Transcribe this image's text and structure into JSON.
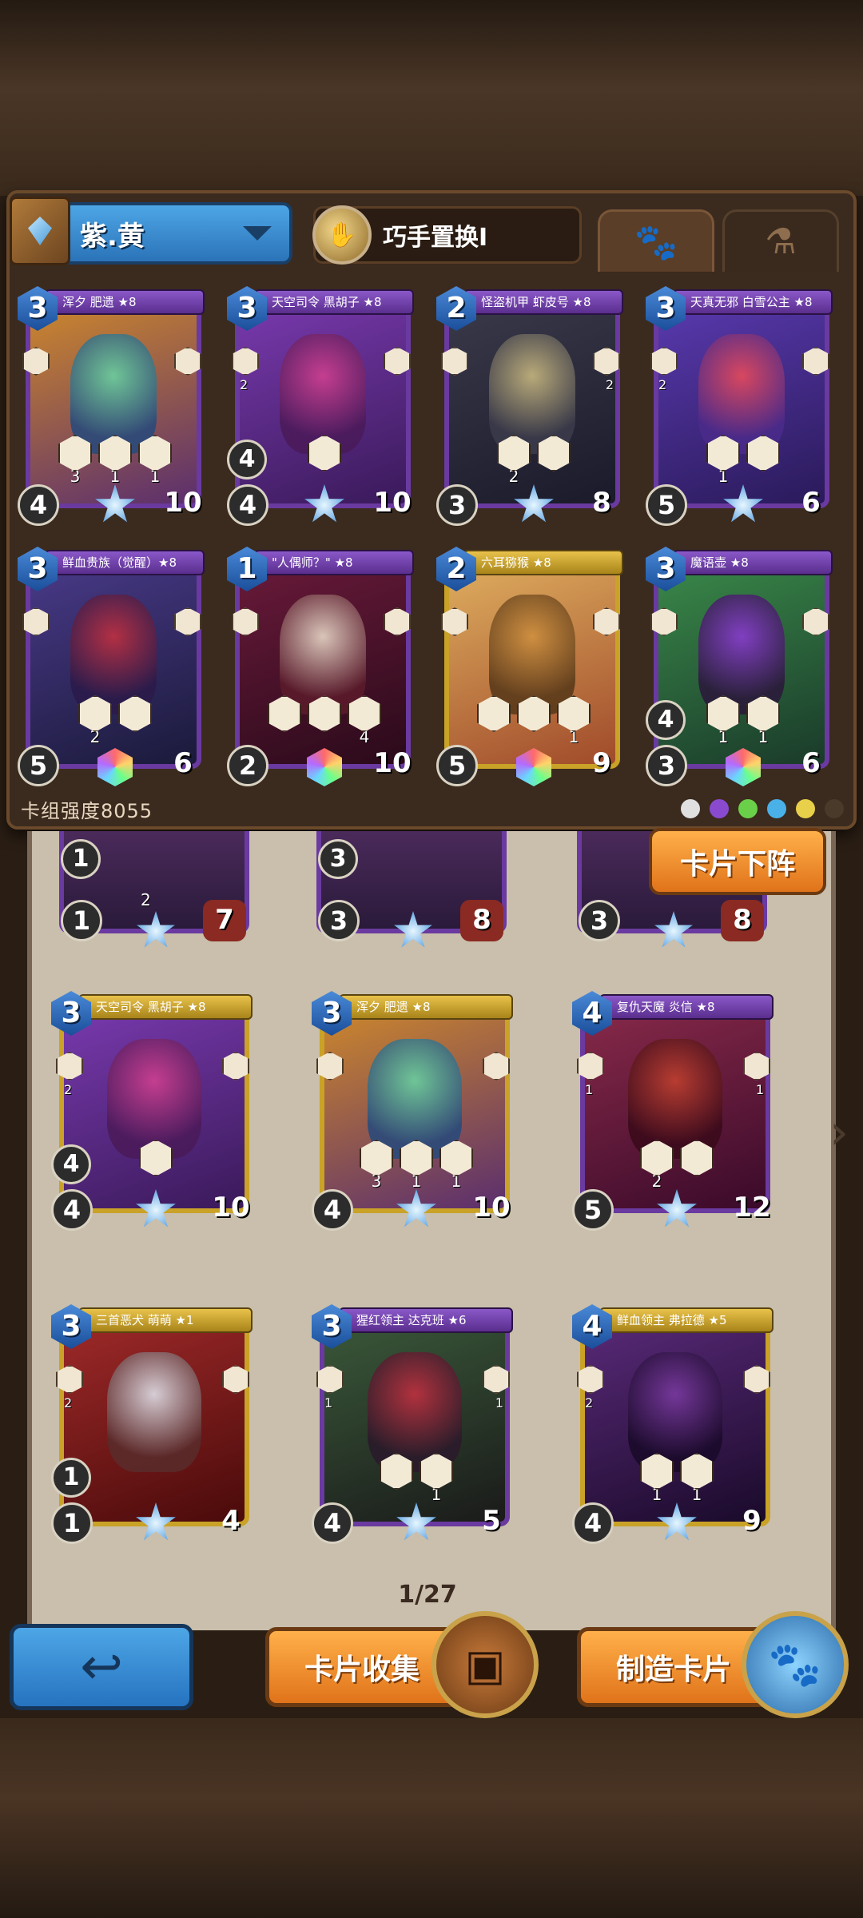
{
  "deck": {
    "name": "紫.黄",
    "mode": "巧手置换I",
    "strength_label": "卡组强度8055",
    "tabs": [
      "paw-icon",
      "potion-icon"
    ]
  },
  "deck_cards": [
    {
      "title": "浑夕 肥遗 ★8",
      "cost": "3",
      "left": "",
      "right": "",
      "abilities": [
        "3",
        "1",
        "1"
      ],
      "atk": "4",
      "extra": "",
      "hp": "10",
      "frame": "purple",
      "c1": "#d08a2a",
      "c2": "#5a2e6e",
      "a1": "#6ad0a0",
      "a2": "#2a4a7a",
      "gem": "star"
    },
    {
      "title": "天空司令 黑胡子 ★8",
      "cost": "3",
      "left": "2",
      "right": "",
      "abilities": [
        ""
      ],
      "atk": "4",
      "extra": "4",
      "hp": "10",
      "frame": "purple",
      "c1": "#7a3ab0",
      "c2": "#3a1a5a",
      "a1": "#d04090",
      "a2": "#4a1a5a",
      "gem": "star"
    },
    {
      "title": "怪盗机甲 虾皮号 ★8",
      "cost": "2",
      "left": "",
      "right": "2",
      "abilities": [
        "2",
        ""
      ],
      "atk": "3",
      "extra": "",
      "hp": "8",
      "frame": "purple",
      "c1": "#3a3a4a",
      "c2": "#1a1a2a",
      "a1": "#c8b880",
      "a2": "#3a3a4a",
      "gem": "star"
    },
    {
      "title": "天真无邪 白雪公主 ★8",
      "cost": "3",
      "left": "2",
      "right": "",
      "abilities": [
        "1",
        ""
      ],
      "atk": "5",
      "extra": "",
      "hp": "6",
      "frame": "purple",
      "c1": "#5a3ab0",
      "c2": "#2a1a5a",
      "a1": "#e84a5a",
      "a2": "#4a2a8a",
      "gem": "star"
    },
    {
      "title": "鲜血贵族（觉醒）★8",
      "cost": "3",
      "left": "",
      "right": "",
      "abilities": [
        "2",
        ""
      ],
      "atk": "5",
      "extra": "",
      "hp": "6",
      "frame": "purple",
      "c1": "#4a3a8a",
      "c2": "#1a1a3a",
      "a1": "#c03040",
      "a2": "#2a1a4a",
      "gem": "rainbow"
    },
    {
      "title": "\"人偶师？\" ★8",
      "cost": "1",
      "left": "",
      "right": "",
      "abilities": [
        "",
        "",
        "4"
      ],
      "atk": "2",
      "extra": "",
      "hp": "10",
      "frame": "purple",
      "c1": "#6a1a3a",
      "c2": "#2a0a1a",
      "a1": "#e8d8c8",
      "a2": "#5a1a2a",
      "gem": "rainbow"
    },
    {
      "title": "六耳猕猴 ★8",
      "cost": "2",
      "left": "",
      "right": "",
      "abilities": [
        "",
        "",
        "1"
      ],
      "atk": "5",
      "extra": "",
      "hp": "9",
      "frame": "gold",
      "c1": "#e0b060",
      "c2": "#a04a2a",
      "a1": "#d09040",
      "a2": "#5a3a1a",
      "gem": "rainbow"
    },
    {
      "title": "魔语壶 ★8",
      "cost": "3",
      "left": "",
      "right": "",
      "abilities": [
        "1",
        "1"
      ],
      "atk": "3",
      "extra": "4",
      "hp": "6",
      "frame": "purple",
      "c1": "#3a8a4a",
      "c2": "#1a3a2a",
      "a1": "#8a3ad0",
      "a2": "#2a1a3a",
      "gem": "rainbow"
    }
  ],
  "collection_partial": [
    {
      "extra": "1",
      "atk": "1",
      "hp": "7",
      "ability": "2"
    },
    {
      "extra": "3",
      "atk": "3",
      "hp": "8",
      "ability": ""
    },
    {
      "extra": "",
      "atk": "3",
      "hp": "8",
      "ability": ""
    }
  ],
  "collection_cards": [
    {
      "title": "天空司令 黑胡子 ★8",
      "cost": "3",
      "left": "2",
      "right": "",
      "abilities": [
        ""
      ],
      "atk": "4",
      "extra": "4",
      "hp": "10",
      "frame": "gold",
      "c1": "#7a3ab0",
      "c2": "#3a1a5a",
      "a1": "#d04090",
      "a2": "#4a1a5a",
      "gem": "star"
    },
    {
      "title": "浑夕 肥遗 ★8",
      "cost": "3",
      "left": "",
      "right": "",
      "abilities": [
        "3",
        "1",
        "1"
      ],
      "atk": "4",
      "extra": "",
      "hp": "10",
      "frame": "gold",
      "c1": "#d08a2a",
      "c2": "#5a2e6e",
      "a1": "#6ad0a0",
      "a2": "#2a4a7a",
      "gem": "star"
    },
    {
      "title": "复仇天魔 炎信 ★8",
      "cost": "4",
      "left": "1",
      "right": "1",
      "abilities": [
        "2",
        ""
      ],
      "atk": "5",
      "extra": "",
      "hp": "12",
      "frame": "purple",
      "c1": "#8a2a4a",
      "c2": "#3a0a2a",
      "a1": "#c04030",
      "a2": "#3a0a1a",
      "gem": "star"
    },
    {
      "title": "三首恶犬 萌萌 ★1",
      "cost": "3",
      "left": "2",
      "right": "",
      "abilities": [],
      "atk": "1",
      "extra": "1",
      "hp": "4",
      "frame": "gold",
      "c1": "#a02a2a",
      "c2": "#4a0a0a",
      "a1": "#e0e0e8",
      "a2": "#5a2a2a",
      "gem": "star"
    },
    {
      "title": "猩红领主 达克班 ★6",
      "cost": "3",
      "left": "1",
      "right": "1",
      "abilities": [
        "",
        "1"
      ],
      "atk": "4",
      "extra": "",
      "hp": "5",
      "frame": "purple",
      "c1": "#3a5a3a",
      "c2": "#1a1a1a",
      "a1": "#c03040",
      "a2": "#2a1a2a",
      "gem": "star"
    },
    {
      "title": "鲜血领主 弗拉德 ★5",
      "cost": "4",
      "left": "2",
      "right": "",
      "abilities": [
        "1",
        "1"
      ],
      "atk": "4",
      "extra": "",
      "hp": "9",
      "frame": "gold",
      "c1": "#5a2a7a",
      "c2": "#1a0a2a",
      "a1": "#7a3aa0",
      "a2": "#1a0a2a",
      "gem": "star"
    }
  ],
  "collection": {
    "unload_label": "卡片下阵",
    "page": "1/27"
  },
  "bottom": {
    "collect_label": "卡片收集",
    "craft_label": "制造卡片"
  }
}
